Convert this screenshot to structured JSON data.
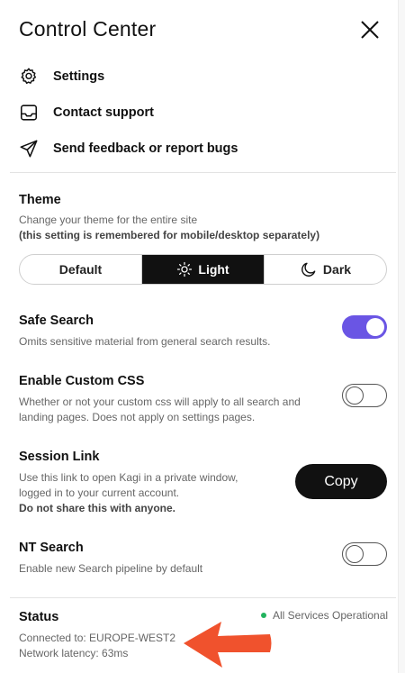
{
  "header": {
    "title": "Control Center"
  },
  "menu": [
    {
      "name": "settings",
      "label": "Settings"
    },
    {
      "name": "contact-support",
      "label": "Contact support"
    },
    {
      "name": "send-feedback",
      "label": "Send feedback or report bugs"
    }
  ],
  "theme": {
    "title": "Theme",
    "desc_line1": "Change your theme for the entire site",
    "desc_line2": "(this setting is remembered for mobile/desktop separately)",
    "options": [
      "Default",
      "Light",
      "Dark"
    ],
    "selected": "Light"
  },
  "safe_search": {
    "title": "Safe Search",
    "desc": "Omits sensitive material from general search results.",
    "enabled": true
  },
  "custom_css": {
    "title": "Enable Custom CSS",
    "desc_line1": "Whether or not your custom css will apply to all search and",
    "desc_line2": "landing pages. Does not apply on settings pages.",
    "enabled": false
  },
  "session_link": {
    "title": "Session Link",
    "desc_line1": "Use this link to open Kagi in a private window,",
    "desc_line2": "logged in to your current account.",
    "warning": "Do not share this with anyone.",
    "copy_label": "Copy"
  },
  "nt_search": {
    "title": "NT Search",
    "desc": "Enable new Search pipeline by default",
    "enabled": false
  },
  "status": {
    "title": "Status",
    "operational": "All Services Operational",
    "connected": "Connected to: EUROPE-WEST2",
    "latency": "Network latency: 63ms"
  },
  "colors": {
    "accent": "#6a55e4",
    "active_bg": "#111111",
    "status_ok": "#22b35e",
    "annotation_arrow": "#f0522d"
  }
}
